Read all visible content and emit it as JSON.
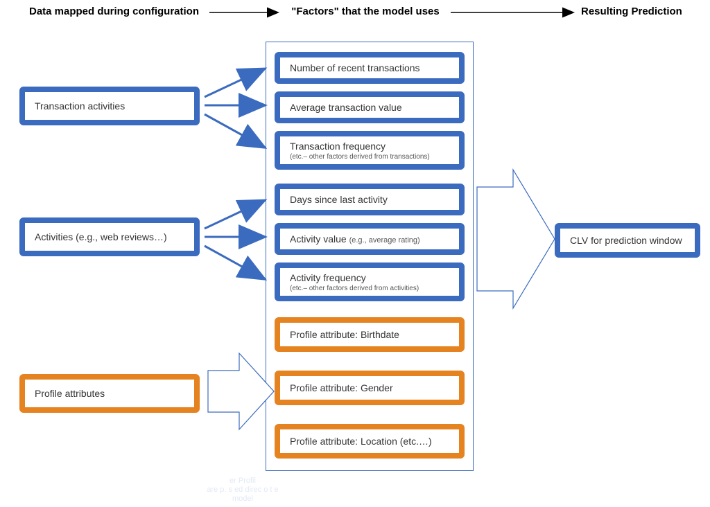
{
  "headers": {
    "left": "Data mapped during configuration",
    "mid": "\"Factors\" that the model uses",
    "right": "Resulting Prediction"
  },
  "inputs": {
    "transactions": "Transaction activities",
    "activities": "Activities (e.g., web reviews…)",
    "profile": "Profile attributes"
  },
  "factors": {
    "f1": "Number of recent transactions",
    "f2": "Average transaction value",
    "f3": "Transaction frequency",
    "f3sub": "(etc.– other factors derived from transactions)",
    "f4": "Days since last activity",
    "f5": "Activity value",
    "f5sub": "(e.g., average rating)",
    "f6": "Activity frequency",
    "f6sub": "(etc.– other factors derived from activities)",
    "p1": "Profile attribute: Birthdate",
    "p2": "Profile attribute: Gender",
    "p3": "Profile attribute: Location (etc.…)"
  },
  "output": {
    "clv": "CLV for prediction window"
  },
  "footer": {
    "line1": "er Profil",
    "line2": "are p. s ed direc  o t e",
    "line3": "model"
  },
  "colors": {
    "blue": "#3b6bbf",
    "orange": "#e58320"
  }
}
